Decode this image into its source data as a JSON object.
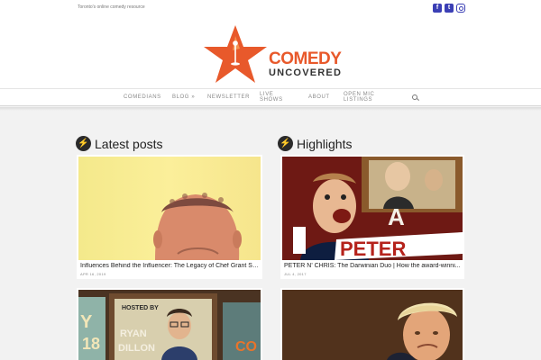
{
  "topbar": {
    "tagline": "Toronto's online comedy resource",
    "social": [
      {
        "icon": "facebook-icon",
        "glyph": "f"
      },
      {
        "icon": "twitter-icon",
        "glyph": "t"
      },
      {
        "icon": "instagram-icon",
        "glyph": ""
      }
    ]
  },
  "logo": {
    "line1": "COMEDY",
    "line2": "UNCOVERED",
    "colors": {
      "star": "#e8592b",
      "text_primary": "#e8592b",
      "text_secondary": "#333333"
    }
  },
  "nav": {
    "items": [
      {
        "label": "COMEDIANS"
      },
      {
        "label": "BLOG »"
      },
      {
        "label": "NEWSLETTER"
      },
      {
        "label": "LIVE SHOWS"
      },
      {
        "label": "ABOUT"
      },
      {
        "label": "OPEN MIC LISTINGS"
      }
    ],
    "search_icon": "search-icon"
  },
  "latest": {
    "title": "Latest posts",
    "posts": [
      {
        "title": "Influences Behind the Influencer: The Legacy of Chef Grant So...",
        "date": "APR 16, 2019"
      },
      {
        "title": "",
        "date": ""
      }
    ]
  },
  "highlights": {
    "title": "Highlights",
    "posts": [
      {
        "title": "PETER N' CHRIS: The Darwinian Duo | How the award-winni...",
        "date": "JUL 4, 2017"
      },
      {
        "title": "",
        "date": ""
      }
    ]
  },
  "thumb_text": {
    "hosted_by": "HOSTED BY",
    "ryan": "RYAN",
    "dillon": "DILLON",
    "y": "Y",
    "eighteen": "18",
    "co": "CO",
    "a_letter": "A",
    "peter": "PETER"
  }
}
